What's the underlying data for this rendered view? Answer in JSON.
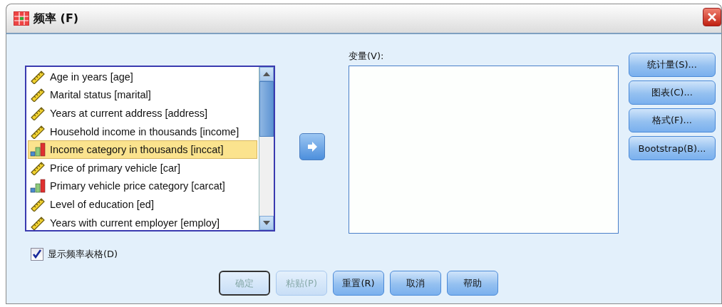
{
  "window": {
    "title": "频率 (F)"
  },
  "source_list": {
    "items": [
      {
        "label": "Age in years [age]",
        "kind": "scale",
        "selected": false
      },
      {
        "label": "Marital status [marital]",
        "kind": "scale",
        "selected": false
      },
      {
        "label": "Years at current address [address]",
        "kind": "scale",
        "selected": false
      },
      {
        "label": "Household income in thousands [income]",
        "kind": "scale",
        "selected": false
      },
      {
        "label": "Income category in thousands [inccat]",
        "kind": "ordinal",
        "selected": true
      },
      {
        "label": "Price of primary vehicle [car]",
        "kind": "scale",
        "selected": false
      },
      {
        "label": "Primary vehicle price category [carcat]",
        "kind": "ordinal",
        "selected": false
      },
      {
        "label": "Level of education [ed]",
        "kind": "scale",
        "selected": false
      },
      {
        "label": "Years with current employer [employ]",
        "kind": "scale",
        "selected": false
      }
    ]
  },
  "variables": {
    "label": "变量(V):"
  },
  "side_buttons": [
    "统计量(S)...",
    "图表(C)...",
    "格式(F)...",
    "Bootstrap(B)..."
  ],
  "display_frequency_tables": {
    "label": "显示频率表格(D)",
    "checked": true
  },
  "buttons": [
    {
      "label": "确定",
      "disabled": true,
      "default": true
    },
    {
      "label": "粘贴(P)",
      "disabled": true,
      "default": false
    },
    {
      "label": "重置(R)",
      "disabled": false,
      "default": false
    },
    {
      "label": "取消",
      "disabled": false,
      "default": false
    },
    {
      "label": "帮助",
      "disabled": false,
      "default": false
    }
  ]
}
